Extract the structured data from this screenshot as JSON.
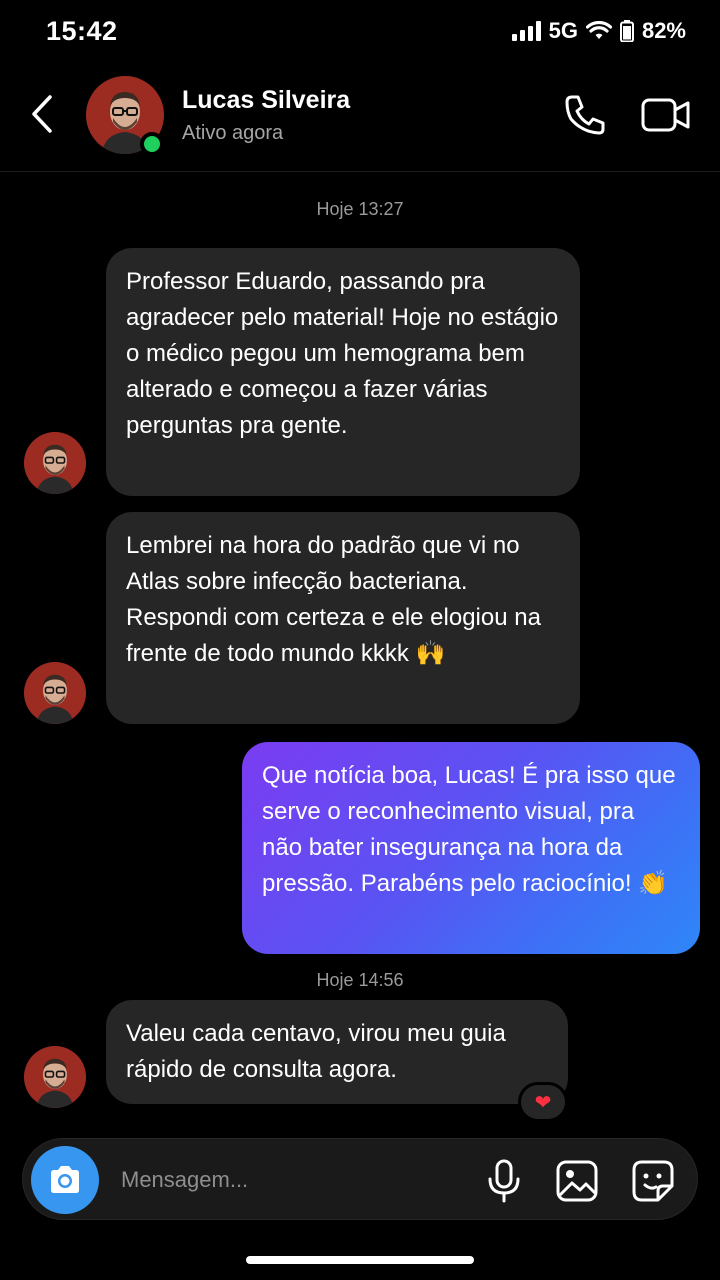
{
  "status_bar": {
    "time": "15:42",
    "network": "5G",
    "battery": "82%"
  },
  "header": {
    "name": "Lucas Silveira",
    "status": "Ativo agora"
  },
  "timestamps": [
    "Hoje 13:27",
    "Hoje 14:56"
  ],
  "messages": [
    {
      "sender": "Lucas Silveira",
      "direction": "in",
      "text": "Professor Eduardo, passando pra agradecer pelo material! Hoje no estágio o médico pegou um hemograma bem alterado e começou a fazer várias perguntas pra gente."
    },
    {
      "sender": "Lucas Silveira",
      "direction": "in",
      "text": "Lembrei na hora do padrão que vi no Atlas sobre infecção bacteriana. Respondi com certeza e ele elogiou na frente de todo mundo kkkk 🙌"
    },
    {
      "sender": "me",
      "direction": "out",
      "text": "Que notícia boa, Lucas! É pra isso que serve o reconhecimento visual, pra não bater insegurança na hora da pressão. Parabéns pelo raciocínio! 👏"
    },
    {
      "sender": "Lucas Silveira",
      "direction": "in",
      "text": "Valeu cada centavo, virou meu guia rápido de consulta agora.",
      "reaction": "❤"
    }
  ],
  "composer": {
    "placeholder": "Mensagem..."
  },
  "colors": {
    "background": "#000000",
    "incoming_bubble": "#262626",
    "outgoing_gradient_start": "#7b3cf2",
    "outgoing_gradient_end": "#2f86f8",
    "online": "#1ed05e",
    "camera_button": "#3797f0"
  },
  "icons": [
    "back-arrow-icon",
    "phone-icon",
    "video-camera-icon",
    "camera-icon",
    "microphone-icon",
    "gallery-icon",
    "sticker-icon",
    "heart-reaction-icon",
    "signal-icon",
    "wifi-icon",
    "battery-icon"
  ]
}
